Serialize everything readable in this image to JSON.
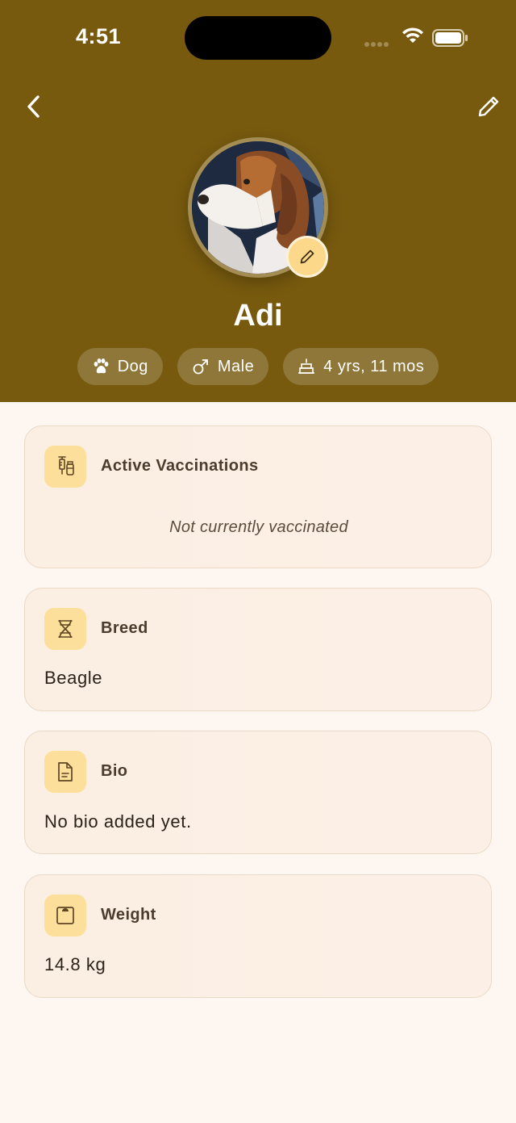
{
  "status_bar": {
    "time": "4:51"
  },
  "pet": {
    "name": "Adi",
    "chips": {
      "species": "Dog",
      "sex": "Male",
      "age": "4 yrs, 11 mos"
    }
  },
  "cards": {
    "vaccinations": {
      "title": "Active Vaccinations",
      "empty_text": "Not currently vaccinated"
    },
    "breed": {
      "title": "Breed",
      "value": "Beagle"
    },
    "bio": {
      "title": "Bio",
      "value": "No bio added yet."
    },
    "weight": {
      "title": "Weight",
      "value": "14.8 kg"
    }
  },
  "icons": {
    "back": "chevron-left-icon",
    "edit": "pencil-icon",
    "species": "paw-icon",
    "sex": "male-symbol-icon",
    "age": "cake-icon",
    "vaccinations": "syringe-vial-icon",
    "breed": "dna-icon",
    "bio": "document-icon",
    "weight": "scale-icon"
  },
  "colors": {
    "header": "#775a0e",
    "background": "#fdf6f1",
    "icon_tile": "#fddf9c",
    "card_border": "#ead9c6"
  }
}
